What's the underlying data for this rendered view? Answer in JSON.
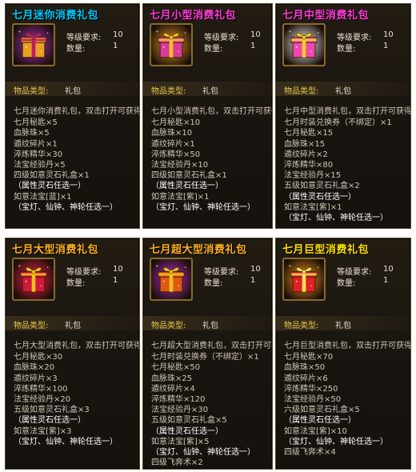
{
  "labels": {
    "level_req": "等级要求:",
    "quantity": "数量:",
    "item_type": "物品类型:"
  },
  "cards": [
    {
      "title": "七月迷你消费礼包",
      "title_color": "#00c8ff",
      "icon": "gift-box-icon",
      "box_color": "#e8a020",
      "ribbon_color": "#c0186a",
      "glow_color": "#b030c8",
      "level_req": "10",
      "quantity": "1",
      "item_type": "礼包",
      "desc": "七月迷你消费礼包，双击打开可获得:",
      "lines": [
        "七月秘匙×5",
        "血脉珠×5",
        "遁纹碎片×1",
        "淬炼精华×30",
        "法宝经验丹×5",
        "四级如意灵石礼盒×1",
        "（属性灵石任选一）",
        "如意法宝[蓝]×1",
        "（宝灯、仙钟、神轮任选一）"
      ]
    },
    {
      "title": "七月小型消费礼包",
      "title_color": "#ff3cd8",
      "icon": "gift-box-icon",
      "box_color": "#d83a9a",
      "ribbon_color": "#f0c020",
      "glow_color": "#f0a020",
      "level_req": "10",
      "quantity": "1",
      "item_type": "礼包",
      "desc": "七月小型消费礼包，双击打开可获得:",
      "lines": [
        "七月秘匙×10",
        "血脉珠×10",
        "遁纹碎片×1",
        "淬炼精华×50",
        "法宝经验丹×10",
        "四级如意灵石礼盒×1",
        "（属性灵石任选一）",
        "如意法宝[紫]×1",
        "（宝灯、仙钟、神轮任选一）"
      ]
    },
    {
      "title": "七月中型消费礼包",
      "title_color": "#ff3cd8",
      "icon": "gift-box-icon",
      "box_color": "#f048b0",
      "ribbon_color": "#f0d020",
      "glow_color": "#ffffff",
      "level_req": "10",
      "quantity": "1",
      "item_type": "礼包",
      "desc": "七月中型消费礼包，双击打开可获得:",
      "lines": [
        "七月时装兑换券（不绑定）×1",
        "七月秘匙×15",
        "血脉珠×15",
        "遁纹碎片×2",
        "淬炼精华×80",
        "法宝经验丹×15",
        "五级如意灵石礼盒×2",
        "（属性灵石任选一）",
        "如意法宝[紫]×1",
        "（宝灯、仙钟、神轮任选一）"
      ]
    },
    {
      "title": "七月大型消费礼包",
      "title_color": "#ffb020",
      "icon": "gift-box-icon",
      "box_color": "#d01838",
      "ribbon_color": "#f0c020",
      "glow_color": "#ff2050",
      "level_req": "10",
      "quantity": "1",
      "item_type": "礼包",
      "desc": "七月大型消费礼包，双击打开可获得:",
      "lines": [
        "七月秘匙×30",
        "血脉珠×20",
        "遁纹碎片×3",
        "淬炼精华×100",
        "法宝经验丹×20",
        "五级如意灵石礼盒×3",
        "（属性灵石任选一）",
        "如意法宝[紫]×3",
        "（宝灯、仙钟、神轮任选一）"
      ]
    },
    {
      "title": "七月超大型消费礼包",
      "title_color": "#ffb020",
      "icon": "gift-box-icon",
      "box_color": "#e05818",
      "ribbon_color": "#f0c020",
      "glow_color": "#c030d0",
      "level_req": "10",
      "quantity": "1",
      "item_type": "礼包",
      "desc": "七月超大型消费礼包，双击打开可获得:",
      "lines": [
        "七月时装兑换券（不绑定）×1",
        "七月秘匙×50",
        "血脉珠×25",
        "遁纹碎片×4",
        "淬炼精华×120",
        "法宝经验丹×30",
        "五级如意灵石礼盒×5",
        "（属性灵石任选一）",
        "如意法宝[紫]×5",
        "（宝灯、仙钟、神轮任选一）",
        "四级飞奔术×2"
      ]
    },
    {
      "title": "七月巨型消费礼包",
      "title_color": "#ffe000",
      "icon": "gift-box-icon",
      "box_color": "#e02020",
      "ribbon_color": "#f8e060",
      "glow_color": "#ff9a20",
      "level_req": "10",
      "quantity": "1",
      "item_type": "礼包",
      "desc": "七月巨型消费礼包，双击打开可获得:",
      "lines": [
        "七月秘匙×70",
        "血脉珠×50",
        "遁纹碎片×6",
        "淬炼精华×250",
        "法宝经验丹×50",
        "六级如意灵石礼盒×5",
        "（属性灵石任选一）",
        "如意法宝[紫]×10",
        "（宝灯、仙钟、神轮任选一）",
        "四级飞奔术×4"
      ]
    }
  ]
}
